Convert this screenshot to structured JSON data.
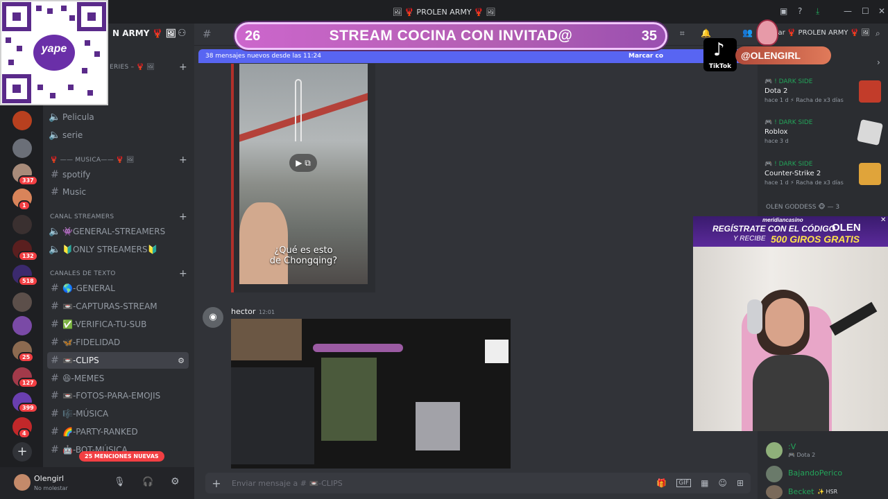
{
  "window": {
    "title": "🖼 🦞 PROLEN ARMY 🦞 🖼"
  },
  "server": {
    "name": "N ARMY 🦞 🖼"
  },
  "stream_overlay": {
    "left_count": "26",
    "title": "STREAM COCINA CON INVITAD@",
    "right_count": "35"
  },
  "tiktok": {
    "label": "TikTok",
    "handle": "@OLENGIRL"
  },
  "qr": {
    "brand": "yape"
  },
  "channels": {
    "cat_series": "ERIES – 🦞 🖼",
    "items_top": [
      {
        "label": "Pelicula"
      },
      {
        "label": "serie"
      }
    ],
    "cat_musica": "🦞 —— MUSICA—— 🦞 🖼",
    "items_musica": [
      {
        "label": "spotify"
      },
      {
        "label": "Music"
      }
    ],
    "cat_streamers": "CANAL STREAMERS",
    "items_streamers": [
      {
        "label": "👾GENERAL-STREAMERS"
      },
      {
        "label": "🔰ONLY STREAMERS🔰"
      }
    ],
    "cat_texto": "CANALES DE TEXTO",
    "items_texto": [
      {
        "label": "🌎-GENERAL"
      },
      {
        "label": "📼-CAPTURAS-STREAM"
      },
      {
        "label": "✅-VERIFICA-TU-SUB"
      },
      {
        "label": "🦋-FIDELIDAD"
      },
      {
        "label": "📼-CLIPS"
      },
      {
        "label": "😆-MEMES"
      },
      {
        "label": "📼-FOTOS-PARA-EMOJIS"
      },
      {
        "label": "🎼-MÚSICA"
      },
      {
        "label": "🌈-PARTY-RANKED"
      },
      {
        "label": "🤖-BOT-MÚSICA"
      }
    ],
    "mentions_pill": "25 MENCIONES NUEVAS"
  },
  "server_badges": [
    "337",
    "1",
    "132",
    "518",
    "25",
    "127",
    "399",
    "4"
  ],
  "user": {
    "name": "Olengirl",
    "status": "No molestar"
  },
  "new_messages": {
    "text": "38 mensajes nuevos desde las 11:24",
    "action": "Marcar co"
  },
  "video_caption": {
    "line1": "¿Qué es esto",
    "line2": "de Chongqing?"
  },
  "message": {
    "author": "hector",
    "time": "12:01"
  },
  "composer": {
    "placeholder": "Enviar mensaje a # 📼-CLIPS"
  },
  "right_header": {
    "title": "car 🦞 PROLEN ARMY 🦞 🖼"
  },
  "activities": [
    {
      "tag": "! DARK SIDE",
      "game": "Dota 2",
      "sub": "hace 1 d  ⚡ Racha de x3 días",
      "color": "#c23c2a"
    },
    {
      "tag": "! DARK SIDE",
      "game": "Roblox",
      "sub": "hace 3 d",
      "color": "#d9d9d9"
    },
    {
      "tag": "! DARK SIDE",
      "game": "Counter-Strike 2",
      "sub": "hace 1 d  ⚡ Racha de x3 días",
      "color": "#e0a43a"
    }
  ],
  "members": {
    "group": "OLEN GODDESS 🐵 — 3",
    "list": [
      {
        "name": ":V",
        "sub": "🎮 Dota 2"
      },
      {
        "name": "BajandoPerico",
        "sub": ""
      },
      {
        "name": "Becket",
        "sub": "✨ HSR"
      }
    ]
  },
  "casino": {
    "brand": "meridiancasino",
    "line1": "REGÍSTRATE CON EL CÓDIGO",
    "code": "OLEN",
    "line2": "Y RECIBE",
    "offer": "500 GIROS GRATIS"
  },
  "colors": {
    "accent": "#5865f2",
    "overlay": "#c064c8",
    "online": "#23a55a"
  }
}
